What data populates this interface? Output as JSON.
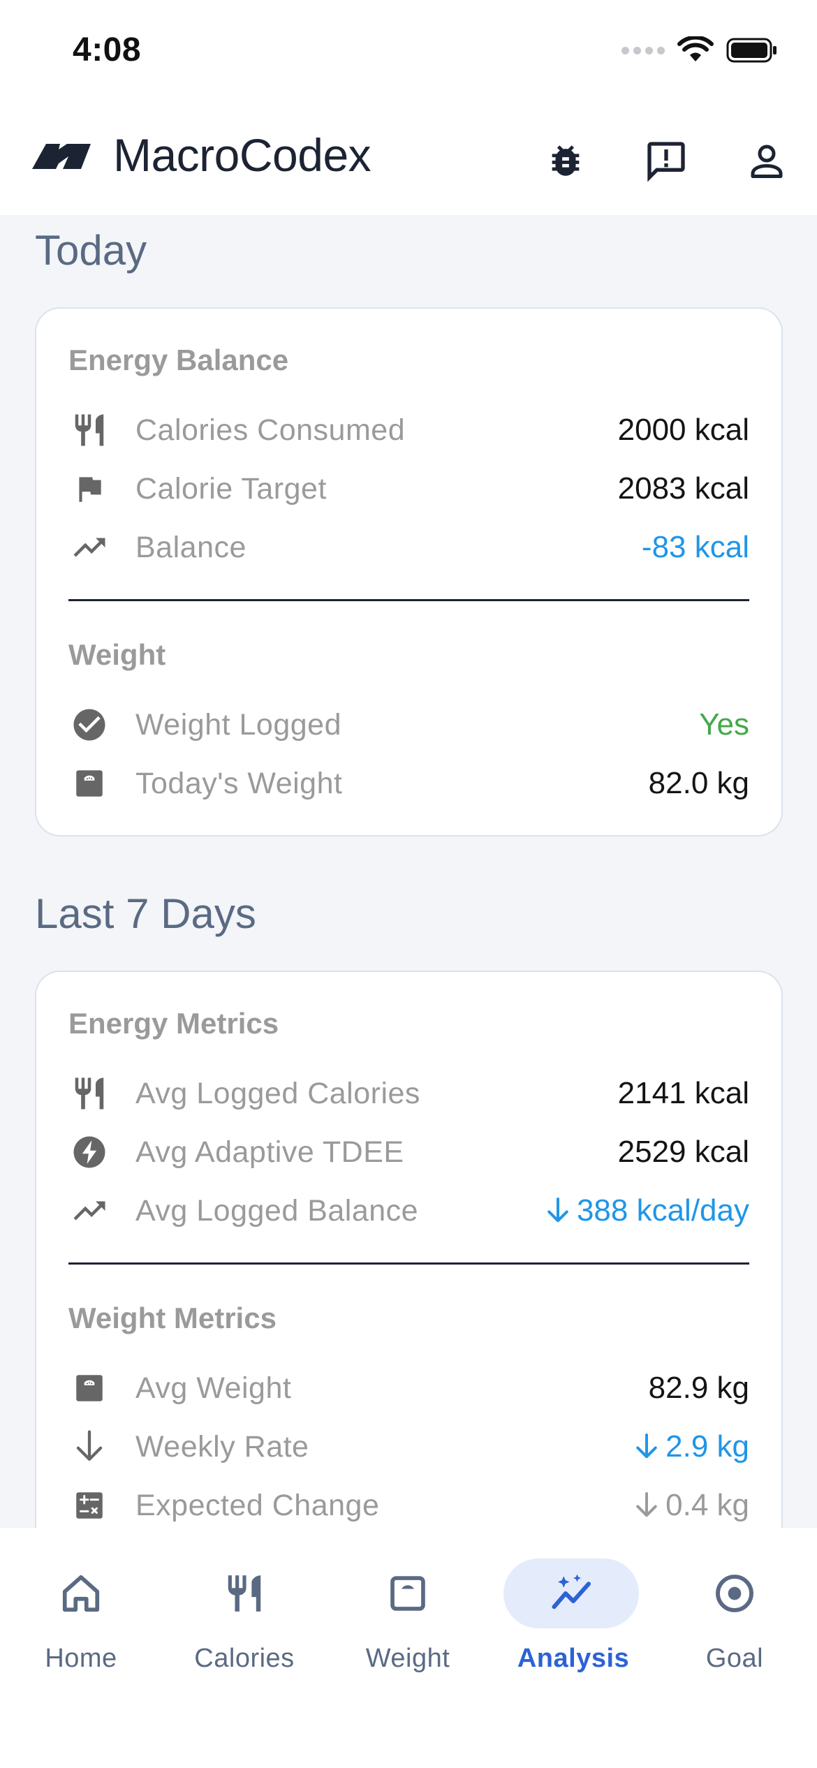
{
  "status_bar": {
    "time": "4:08"
  },
  "header": {
    "title": "MacroCodex",
    "actions": [
      "bug-report",
      "feedback",
      "profile"
    ]
  },
  "today": {
    "title": "Today",
    "energy": {
      "title": "Energy Balance",
      "rows": [
        {
          "icon": "fork-knife-icon",
          "label": "Calories Consumed",
          "value": "2000 kcal"
        },
        {
          "icon": "flag-icon",
          "label": "Calorie Target",
          "value": "2083 kcal"
        },
        {
          "icon": "trending-up-icon",
          "label": "Balance",
          "value": "-83 kcal"
        }
      ]
    },
    "weight": {
      "title": "Weight",
      "rows": [
        {
          "icon": "check-circle-icon",
          "label": "Weight Logged",
          "value": "Yes"
        },
        {
          "icon": "scale-icon",
          "label": "Today's Weight",
          "value": "82.0 kg"
        }
      ]
    }
  },
  "last7": {
    "title": "Last 7 Days",
    "energy": {
      "title": "Energy Metrics",
      "rows": [
        {
          "icon": "fork-knife-icon",
          "label": "Avg Logged Calories",
          "value": "2141 kcal"
        },
        {
          "icon": "bolt-circle-icon",
          "label": "Avg Adaptive TDEE",
          "value": "2529 kcal"
        },
        {
          "icon": "trending-up-icon",
          "label": "Avg Logged Balance",
          "value": "388 kcal/day"
        }
      ]
    },
    "weight": {
      "title": "Weight Metrics",
      "rows": [
        {
          "icon": "scale-icon",
          "label": "Avg Weight",
          "value": "82.9 kg"
        },
        {
          "icon": "arrow-down-icon",
          "label": "Weekly Rate",
          "value": "2.9 kg"
        },
        {
          "icon": "calculator-icon",
          "label": "Expected Change",
          "value": "0.4 kg"
        }
      ]
    }
  },
  "nav": {
    "items": [
      {
        "label": "Home",
        "icon": "home-icon"
      },
      {
        "label": "Calories",
        "icon": "fork-knife-icon"
      },
      {
        "label": "Weight",
        "icon": "scale-icon"
      },
      {
        "label": "Analysis",
        "icon": "analysis-icon",
        "active": true
      },
      {
        "label": "Goal",
        "icon": "target-icon"
      }
    ]
  },
  "colors": {
    "accent": "#2d62d6",
    "positive_blue": "#1e96e8",
    "success_green": "#45a84a",
    "heading": "#5b6a83"
  }
}
